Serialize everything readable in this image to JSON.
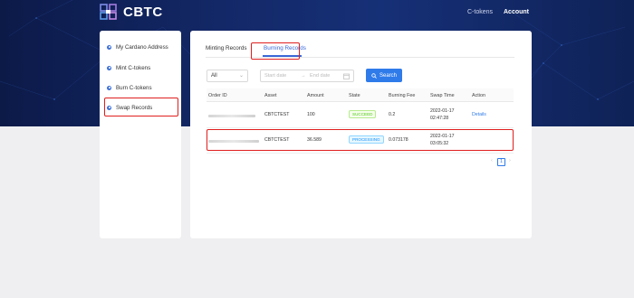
{
  "brand": {
    "name": "CBTC"
  },
  "topnav": {
    "items": [
      {
        "label": "C-tokens"
      },
      {
        "label": "Account"
      }
    ]
  },
  "sidebar": {
    "items": [
      {
        "label": "My Cardano Address"
      },
      {
        "label": "Mint C-tokens"
      },
      {
        "label": "Burn C-tokens"
      },
      {
        "label": "Swap Records"
      }
    ]
  },
  "tabs": [
    {
      "label": "Minting Records"
    },
    {
      "label": "Burning Records"
    }
  ],
  "filters": {
    "select_value": "All",
    "start_placeholder": "Start date",
    "end_placeholder": "End date",
    "search_label": "Search",
    "range_arrow": "→"
  },
  "table": {
    "headers": [
      "Order ID",
      "Asset",
      "Amount",
      "State",
      "Burning Fee",
      "Swap Time",
      "Action"
    ],
    "rows": [
      {
        "asset": "CBTCTEST",
        "amount": "100",
        "state": "SUCCEED",
        "fee": "0.2",
        "date": "2022-01-17",
        "time": "02:47:28",
        "action": "Details"
      },
      {
        "asset": "CBTCTEST",
        "amount": "36.589",
        "state": "PROCESSING",
        "fee": "0.073178",
        "date": "2022-01-17",
        "time": "03:05:32",
        "action": ""
      }
    ]
  },
  "pagination": {
    "current": "1",
    "prev": "‹",
    "next": "›"
  },
  "colors": {
    "accent": "#2f7bea",
    "hero": "#132867",
    "highlight": "#e01e1e",
    "success": "#52c41a",
    "processing": "#1890ff"
  },
  "icons": {
    "logo": "cbtc-logo-icon",
    "sidebar": "radio-dot-icon",
    "search": "search-icon",
    "calendar": "calendar-icon",
    "dropdown": "chevron-down-icon"
  }
}
